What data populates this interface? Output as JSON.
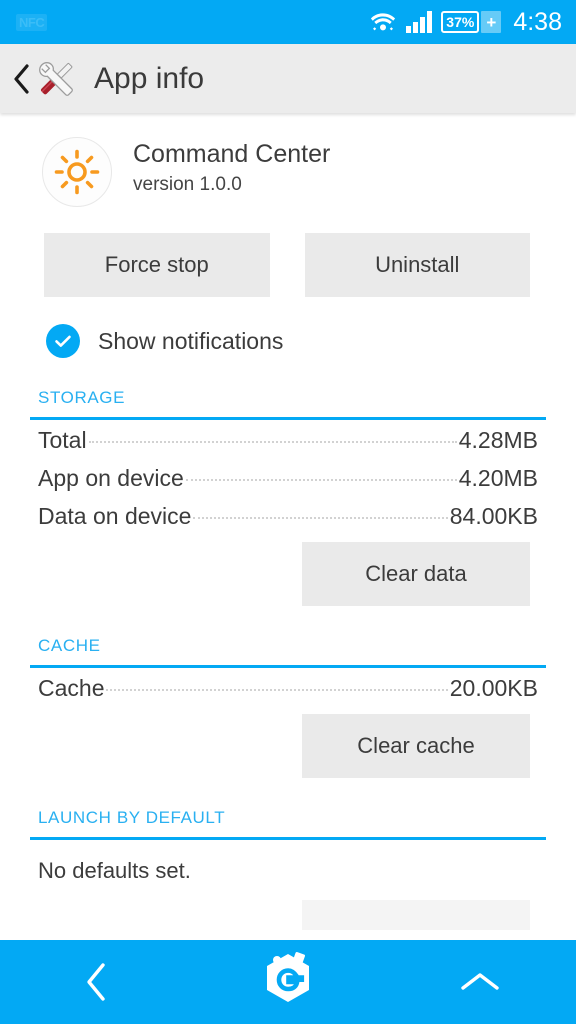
{
  "status_bar": {
    "nfc_label": "NFC",
    "wifi_icon": "wifi-icon",
    "signal_icon": "cell-signal-icon",
    "battery_percent": "37%",
    "battery_charging_icon": "battery-plus-icon",
    "time": "4:38",
    "background_color": "#03A9F4"
  },
  "app_bar": {
    "back_icon": "back-chevron-icon",
    "tools_icon": "tools-icon",
    "title": "App info",
    "background_color": "#ECECEC"
  },
  "app": {
    "icon": "sun-icon",
    "icon_color": "#F79A1F",
    "name": "Command Center",
    "version": "version 1.0.0"
  },
  "actions": {
    "force_stop_label": "Force stop",
    "uninstall_label": "Uninstall"
  },
  "notifications": {
    "checkbox_icon": "checkmark-icon",
    "checked": true,
    "label": "Show notifications",
    "accent_color": "#03A9F4"
  },
  "sections": [
    {
      "title": "STORAGE",
      "rows": [
        {
          "key": "Total",
          "value": "4.28MB"
        },
        {
          "key": "App on device",
          "value": "4.20MB"
        },
        {
          "key": "Data on device",
          "value": "84.00KB"
        }
      ],
      "button": "Clear data"
    },
    {
      "title": "CACHE",
      "rows": [
        {
          "key": "Cache",
          "value": "20.00KB"
        }
      ],
      "button": "Clear cache"
    },
    {
      "title": "LAUNCH BY DEFAULT",
      "note": "No defaults set."
    }
  ],
  "nav_bar": {
    "back_icon": "nav-back-chevron-icon",
    "home_icon": "hexagon-g-logo-icon",
    "up_icon": "nav-up-chevron-icon",
    "background_color": "#03A9F4"
  },
  "theme": {
    "accent": "#03A9F4",
    "section_title": "#29B0F1",
    "text": "#3C3C3C",
    "button_bg": "#EAEAEA"
  }
}
